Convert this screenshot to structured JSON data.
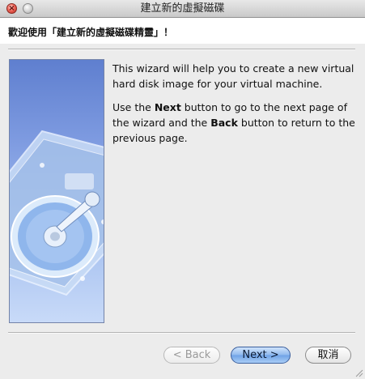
{
  "window": {
    "title": "建立新的虛擬磁碟",
    "close_symbol": "×"
  },
  "header": {
    "text": "歡迎使用「建立新的虛擬磁碟精靈」！"
  },
  "side_image": {
    "icon": "hard-disk-icon"
  },
  "body": {
    "p1": "This wizard will help you to create a new virtual hard disk image for your virtual machine.",
    "p2_part1": "Use the ",
    "p2_next": "Next",
    "p2_part2": " button to go to the next page of the wizard and the ",
    "p2_back": "Back",
    "p2_part3": " button to return to the previous page."
  },
  "buttons": {
    "back": "< Back",
    "next": "Next >",
    "cancel": "取消"
  },
  "colors": {
    "accent": "#6fa2e6",
    "image_top": "#5f7fcf",
    "image_bottom": "#c8daf8"
  }
}
